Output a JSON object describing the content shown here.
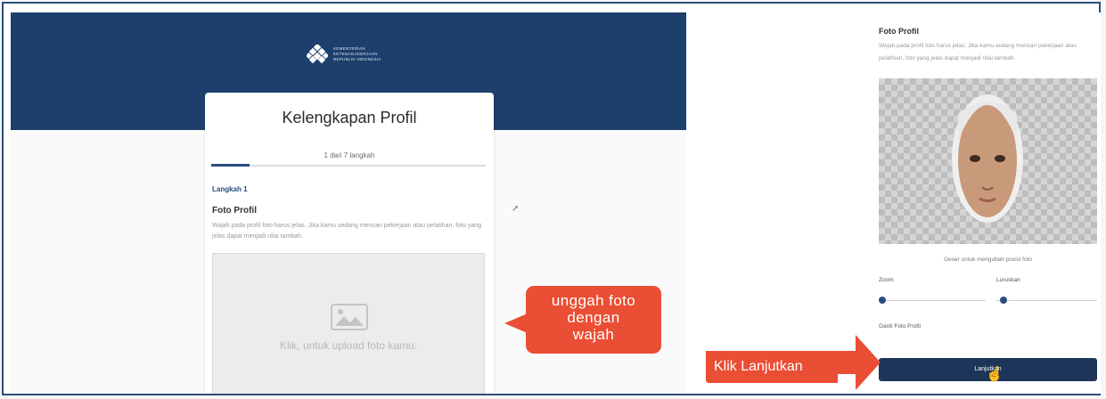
{
  "left_panel": {
    "logo_text": "KEMENTERIAN KETENAGAKERJAAN REPUBLIK INDONESIA",
    "card_title": "Kelengkapan Profil",
    "steps_text": "1 dari 7 langkah",
    "progress_fraction": 0.14,
    "step_label": "Langkah 1",
    "section_title": "Foto Profil",
    "section_desc": "Wajah pada profil foto harus jelas. Jika kamu sedang mencari pekerjaan atau pelatihan, foto yang jelas dapat menjadi nilai tambah.",
    "upload_text": "Klik, untuk upload foto kamu."
  },
  "callout": {
    "line1": "unggah foto",
    "line2": "dengan",
    "line3": "wajah"
  },
  "right_panel": {
    "section_title": "Foto Profil",
    "section_desc": "Wajah pada profil foto harus jelas. Jika kamu sedang mencari pekerjaan atau pelatihan, foto yang jelas dapat menjadi nilai tambah.",
    "hint": "Geser untuk mengubah posisi foto",
    "zoom_label": "Zoom",
    "rotate_label": "Luruskan",
    "change_photo": "Ganti Foto Profil",
    "next_button": "Lanjutkan",
    "instruction": "Klik Lanjutkan"
  },
  "colors": {
    "brand_navy": "#1c3f6c",
    "accent_orange": "#ea4e34",
    "button_navy": "#1c3558"
  }
}
